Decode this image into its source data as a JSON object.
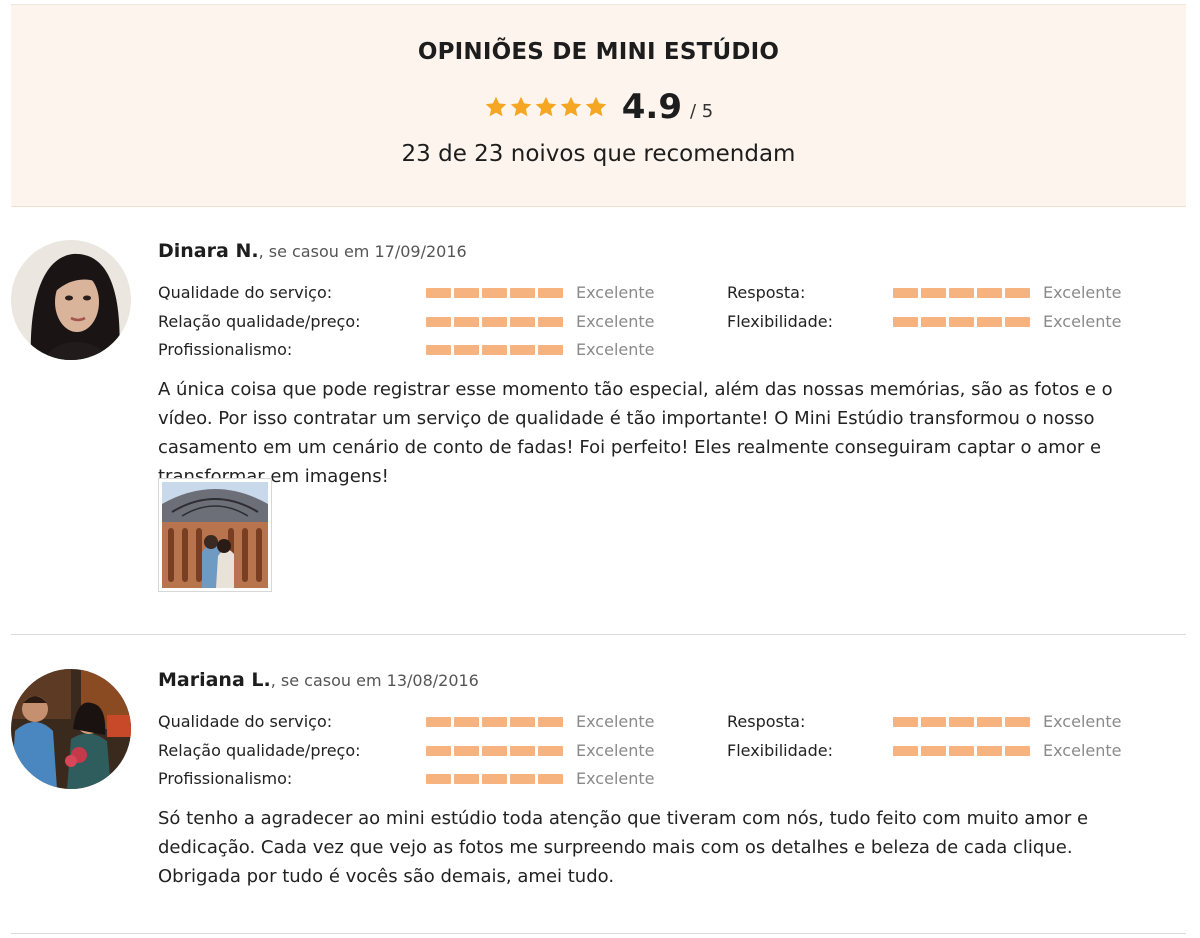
{
  "summary": {
    "title": "OPINIÕES DE MINI ESTÚDIO",
    "score": "4.9",
    "score_max": "/ 5",
    "star_rating": 4.9,
    "recommend_text": "23 de 23 noivos que recomendam"
  },
  "colors": {
    "summary_bg": "#fdf4ed",
    "star": "#f5a623",
    "rating_bar": "#f6b27f",
    "verdict_text": "#8a8a8a"
  },
  "reviews": [
    {
      "name": "Dinara N.",
      "married_text": ", se casou em 17/09/2016",
      "ratings": [
        {
          "label": "Qualidade do serviço:",
          "verdict": "Excelente",
          "level": 1.0
        },
        {
          "label": "Relação qualidade/preço:",
          "verdict": "Excelente",
          "level": 1.0
        },
        {
          "label": "Profissionalismo:",
          "verdict": "Excelente",
          "level": 1.0
        },
        {
          "label": "Resposta:",
          "verdict": "Excelente",
          "level": 1.0
        },
        {
          "label": "Flexibilidade:",
          "verdict": "Excelente",
          "level": 1.0
        }
      ],
      "text": "A única coisa que pode registrar esse momento tão especial, além das nossas memórias, são as fotos e o vídeo. Por isso contratar um serviço de qualidade é tão importante! O Mini Estúdio transformou o nosso casamento em um cenário de conto de fadas! Foi perfeito! Eles realmente conseguiram captar o amor e transformar em imagens!"
    },
    {
      "name": "Mariana L.",
      "married_text": ", se casou em 13/08/2016",
      "ratings": [
        {
          "label": "Qualidade do serviço:",
          "verdict": "Excelente",
          "level": 1.0
        },
        {
          "label": "Relação qualidade/preço:",
          "verdict": "Excelente",
          "level": 1.0
        },
        {
          "label": "Profissionalismo:",
          "verdict": "Excelente",
          "level": 1.0
        },
        {
          "label": "Resposta:",
          "verdict": "Excelente",
          "level": 1.0
        },
        {
          "label": "Flexibilidade:",
          "verdict": "Excelente",
          "level": 1.0
        }
      ],
      "text": "Só tenho a agradecer ao mini estúdio toda atenção que tiveram com nós, tudo feito com muito amor e dedicação. Cada vez que vejo as fotos me surpreendo mais com os detalhes e beleza de cada clique. Obrigada por tudo é vocês são demais, amei tudo."
    }
  ]
}
